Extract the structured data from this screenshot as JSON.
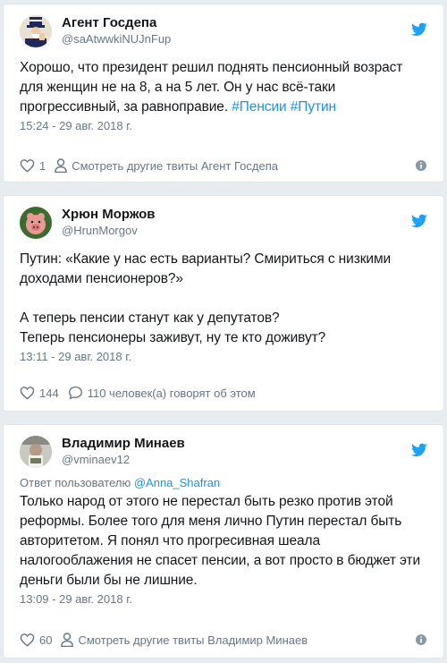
{
  "colors": {
    "background": "#e6ecf0",
    "accent": "#1b95e0",
    "muted": "#657786",
    "twitter_blue": "#1da1f2"
  },
  "tweets": [
    {
      "display_name": "Агент Госдепа",
      "handle": "@saAtwwkiNUJnFup",
      "text_lines": [
        "Хорошо, что президент решил поднять пенсионный возраст",
        "для женщин не на 8, а на 5 лет. Он у нас всё-таки",
        "прогрессивный, за равноправие. "
      ],
      "hashtags": [
        "#Пенсии",
        "#Путин"
      ],
      "timestamp": "15:24 - 29 авг. 2018 г.",
      "likes": "1",
      "secondary_action": "Смотреть другие твиты Агент Госдепа",
      "secondary_icon": "person-icon"
    },
    {
      "display_name": "Хрюн Моржов",
      "handle": "@HrunMorgov",
      "text_lines": [
        "Путин: «Какие у нас есть варианты? Смириться с низкими",
        "доходами пенсионеров?»",
        "",
        "А теперь пенсии станут как у депутатов?",
        "Теперь пенсионеры заживут, ну те кто доживут?"
      ],
      "timestamp": "13:11 - 29 авг. 2018 г.",
      "likes": "144",
      "secondary_action": "110 человек(а) говорят об этом",
      "secondary_icon": "comment-icon"
    },
    {
      "display_name": "Владимир Минаев",
      "handle": "@vminaev12",
      "reply_prefix": "Ответ пользователю ",
      "reply_mention": "@Anna_Shafran",
      "text_lines": [
        "Только народ от этого не перестал быть резко против этой",
        "реформы. Более того для меня лично Путин перестал быть",
        "авторитетом. Я понял что прогресивная шеала",
        "налогооблажения не спасет пенсии, а вот просто в бюджет эти",
        "деньги были бы не лишние."
      ],
      "timestamp": "13:09 - 29 авг. 2018 г.",
      "likes": "60",
      "secondary_action": "Смотреть другие твиты Владимир Минаев",
      "secondary_icon": "person-icon"
    }
  ]
}
